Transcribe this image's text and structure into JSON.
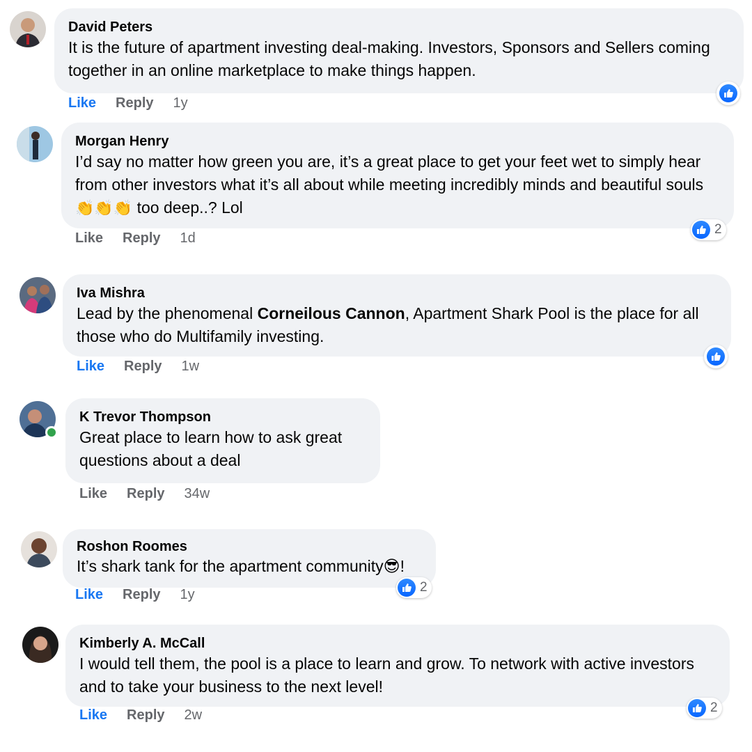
{
  "comments": [
    {
      "author": "David Peters",
      "text": "It is the future of apartment investing deal-making. Investors, Sponsors and Sellers coming together in an online marketplace to make things happen.",
      "actions": {
        "like": "Like",
        "reply": "Reply",
        "time": "1y"
      },
      "like_active": true,
      "reaction_count": ""
    },
    {
      "author": "Morgan Henry",
      "text_before": "I’d say no matter how green you are, it’s a great place to get your feet wet to simply hear from other investors what it’s all about while meeting incredibly minds and beautiful souls",
      "emoji": "👏👏👏",
      "text_after": "too deep..? Lol",
      "actions": {
        "like": "Like",
        "reply": "Reply",
        "time": "1d"
      },
      "like_active": false,
      "reaction_count": "2"
    },
    {
      "author": "Iva Mishra",
      "text_before": "Lead by the phenomenal",
      "bold": "Corneilous Cannon",
      "text_after": ", Apartment Shark Pool is the place for all those who do Multifamily investing.",
      "actions": {
        "like": "Like",
        "reply": "Reply",
        "time": "1w"
      },
      "like_active": true,
      "reaction_count": ""
    },
    {
      "author": "K Trevor Thompson",
      "text": "Great place to learn how to ask great questions about a deal",
      "actions": {
        "like": "Like",
        "reply": "Reply",
        "time": "34w"
      },
      "like_active": false,
      "online": true
    },
    {
      "author": "Roshon Roomes",
      "text_before": "It’s shark tank for the apartment community",
      "emoji": "😎",
      "text_after": "!",
      "actions": {
        "like": "Like",
        "reply": "Reply",
        "time": "1y"
      },
      "like_active": true,
      "reaction_count": "2"
    },
    {
      "author": "Kimberly A. McCall",
      "text": "I would tell them, the pool is a place to learn and grow. To network with active investors and to take your business to the next level!",
      "actions": {
        "like": "Like",
        "reply": "Reply",
        "time": "2w"
      },
      "like_active": true,
      "reaction_count": "2"
    }
  ],
  "colors": {
    "bubble": "#f0f2f5",
    "like_active": "#1877f2",
    "meta": "#65676b",
    "online": "#31a24c"
  },
  "icons": [
    "like-thumb-icon",
    "online-status-icon"
  ]
}
